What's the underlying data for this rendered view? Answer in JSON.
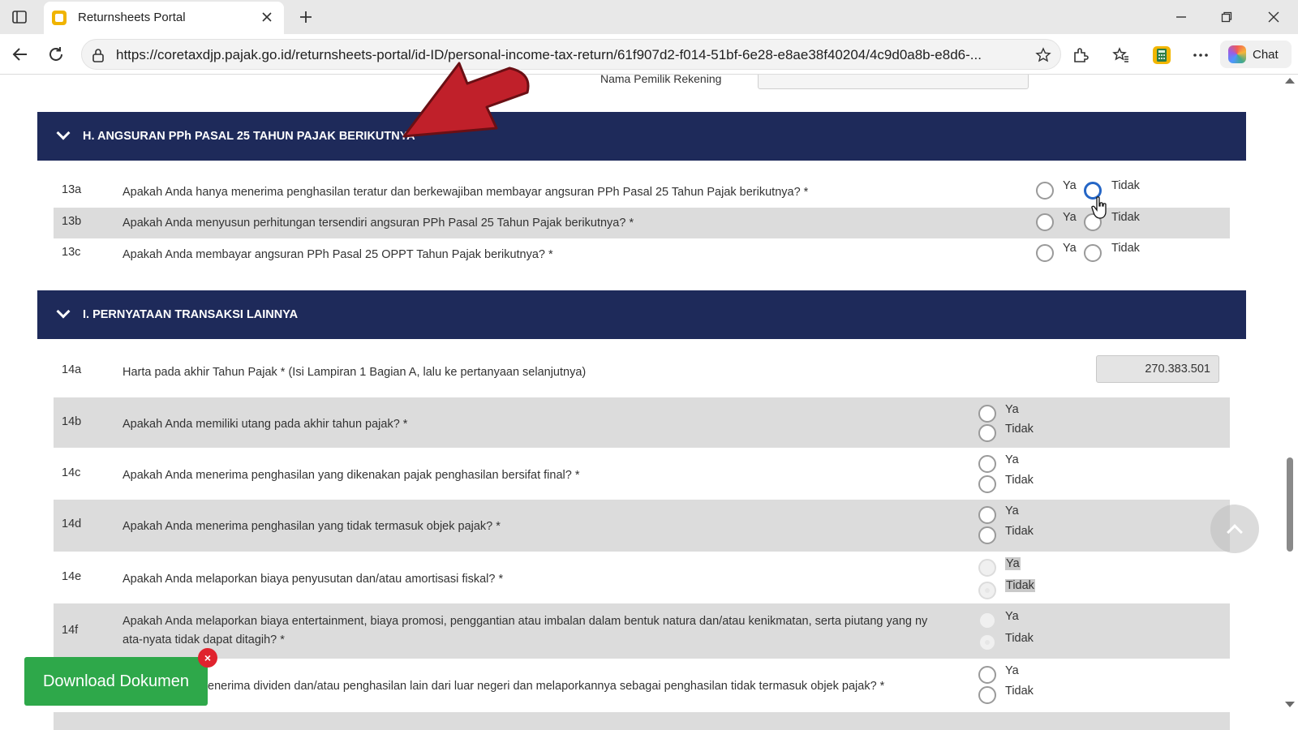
{
  "browser": {
    "tab_title": "Returnsheets Portal",
    "url": "https://coretaxdjp.pajak.go.id/returnsheets-portal/id-ID/personal-income-tax-return/61f907d2-f014-51bf-6e28-e8ae38f40204/4c9d0a8b-e8d6-...",
    "chat_label": "Chat",
    "icons": [
      "sidebar-toggle-icon",
      "close-icon",
      "plus-icon",
      "minimize-icon",
      "restore-icon",
      "close-window-icon",
      "back-arrow-icon",
      "refresh-icon",
      "lock-icon",
      "star-icon",
      "extensions-icon",
      "favorites-icon",
      "calculator-icon",
      "more-icon",
      "copilot-icon"
    ]
  },
  "form": {
    "bank_owner_label": "Nama Pemilik Rekening",
    "section_h": {
      "title": "H. ANGSURAN PPh PASAL 25 TAHUN PAJAK BERIKUTNYA",
      "questions": [
        {
          "num": "13a",
          "text": "Apakah Anda hanya menerima penghasilan teratur dan berkewajiban membayar angsuran PPh Pasal 25 Tahun Pajak berikutnya? *",
          "yes": "Ya",
          "no": "Tidak"
        },
        {
          "num": "13b",
          "text": "Apakah Anda menyusun perhitungan tersendiri angsuran PPh Pasal 25 Tahun Pajak berikutnya? *",
          "yes": "Ya",
          "no": "Tidak"
        },
        {
          "num": "13c",
          "text": "Apakah Anda membayar angsuran PPh Pasal 25 OPPT Tahun Pajak berikutnya? *",
          "yes": "Ya",
          "no": "Tidak"
        }
      ]
    },
    "section_i": {
      "title": "I. PERNYATAAN TRANSAKSI LAINNYA",
      "questions": [
        {
          "num": "14a",
          "text": "Harta pada akhir Tahun Pajak * (Isi Lampiran 1 Bagian A, lalu ke pertanyaan selanjutnya)",
          "value": "270.383.501"
        },
        {
          "num": "14b",
          "text": "Apakah Anda memiliki utang pada akhir tahun pajak? *",
          "yes": "Ya",
          "no": "Tidak"
        },
        {
          "num": "14c",
          "text": "Apakah Anda menerima penghasilan yang dikenakan pajak penghasilan bersifat final? *",
          "yes": "Ya",
          "no": "Tidak"
        },
        {
          "num": "14d",
          "text": "Apakah Anda menerima penghasilan yang tidak termasuk objek pajak? *",
          "yes": "Ya",
          "no": "Tidak"
        },
        {
          "num": "14e",
          "text": "Apakah Anda melaporkan biaya penyusutan dan/atau amortisasi fiskal? *",
          "yes": "Ya",
          "no": "Tidak"
        },
        {
          "num": "14f",
          "text_line1": "Apakah Anda melaporkan biaya entertainment, biaya promosi, penggantian atau imbalan dalam bentuk natura dan/atau kenikmatan, serta piutang yang ny",
          "text_line2": "ata-nyata tidak dapat ditagih? *",
          "yes": "Ya",
          "no": "Tidak"
        },
        {
          "text": "enerima dividen dan/atau penghasilan lain dari luar negeri dan melaporkannya sebagai penghasilan tidak termasuk objek pajak? *",
          "yes": "Ya",
          "no": "Tidak"
        }
      ]
    }
  },
  "download": {
    "label": "Download Dokumen",
    "dismiss": "×"
  },
  "colors": {
    "section_header": "#1e2a5a",
    "download_button": "#2ea84a",
    "annotation_arrow": "#c0202a",
    "radio_focus": "#2566c6"
  }
}
